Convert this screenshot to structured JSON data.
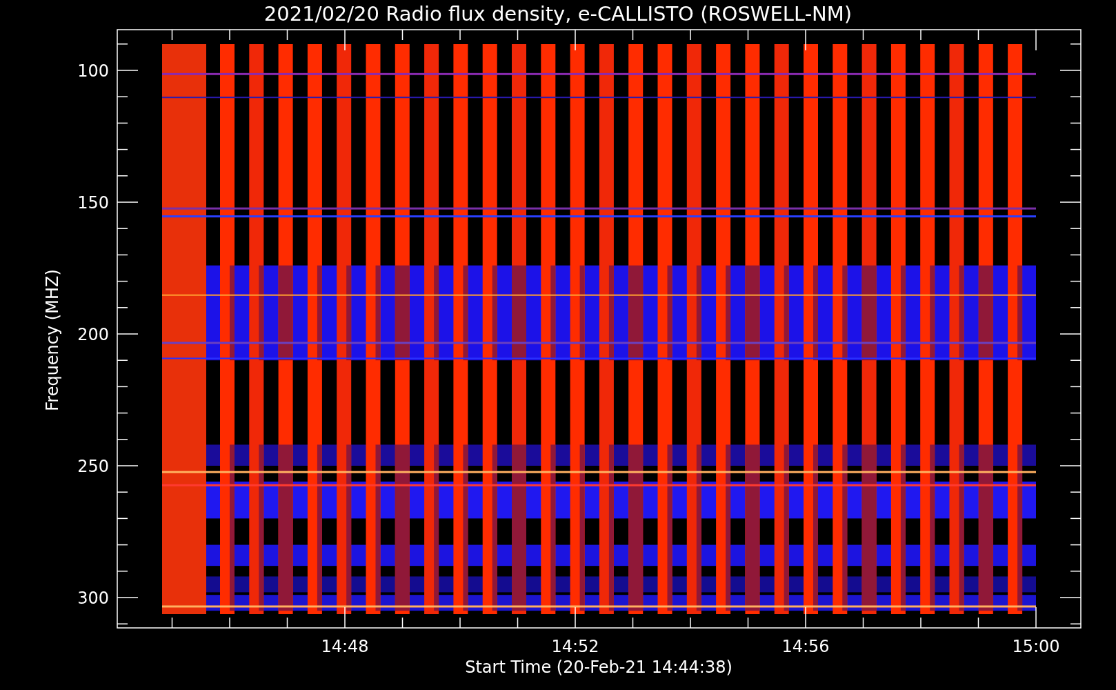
{
  "plot": {
    "title": "2021/02/20  Radio flux density, e-CALLISTO (ROSWELL-NM)",
    "ylabel": "Frequency (MHZ)",
    "yticks": [
      "100",
      "150",
      "200",
      "250",
      "300"
    ],
    "xlabel": "Start Time (20-Feb-21 14:44:38)",
    "xticks": [
      "14:48",
      "14:52",
      "14:56",
      "15:00"
    ]
  }
}
